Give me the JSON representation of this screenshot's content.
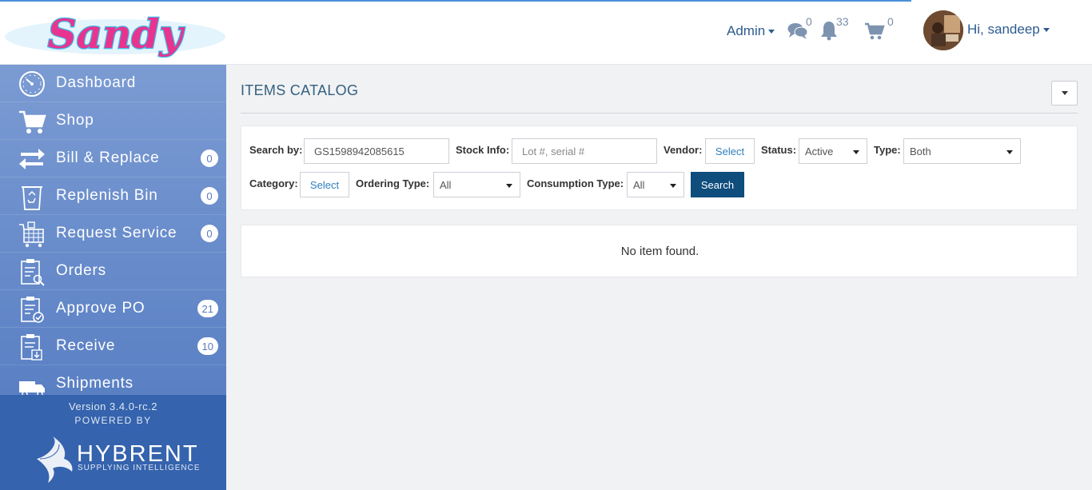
{
  "header": {
    "logo_text": "Sandy",
    "admin_label": "Admin",
    "messages_count": "0",
    "notifications_count": "33",
    "cart_count": "0",
    "greeting": "Hi, sandeep"
  },
  "sidebar": {
    "items": [
      {
        "label": "Dashboard",
        "icon": "dashboard-gauge-icon",
        "badge": ""
      },
      {
        "label": "Shop",
        "icon": "shopping-cart-icon",
        "badge": ""
      },
      {
        "label": "Bill & Replace",
        "icon": "exchange-arrows-icon",
        "badge": "0"
      },
      {
        "label": "Replenish Bin",
        "icon": "recycle-bin-icon",
        "badge": "0"
      },
      {
        "label": "Request Service",
        "icon": "service-cart-icon",
        "badge": "0"
      },
      {
        "label": "Orders",
        "icon": "clipboard-search-icon",
        "badge": ""
      },
      {
        "label": "Approve PO",
        "icon": "clipboard-check-icon",
        "badge": "21"
      },
      {
        "label": "Receive",
        "icon": "clipboard-download-icon",
        "badge": "10"
      },
      {
        "label": "Shipments",
        "icon": "truck-icon",
        "badge": ""
      }
    ],
    "version": "Version 3.4.0-rc.2",
    "powered_by": "POWERED BY",
    "brand_name": "HYBRENT",
    "brand_tagline": "SUPPLYING INTELLIGENCE"
  },
  "main": {
    "title": "ITEMS CATALOG",
    "filters": {
      "search_by_label": "Search by:",
      "search_by_value": "GS1598942085615",
      "stock_info_label": "Stock Info:",
      "stock_info_placeholder": "Lot #, serial #",
      "vendor_label": "Vendor:",
      "vendor_button": "Select",
      "status_label": "Status:",
      "status_value": "Active",
      "type_label": "Type:",
      "type_value": "Both",
      "category_label": "Category:",
      "category_button": "Select",
      "ordering_type_label": "Ordering Type:",
      "ordering_type_value": "All",
      "consumption_type_label": "Consumption Type:",
      "consumption_type_value": "All",
      "search_button": "Search"
    },
    "empty_message": "No item found."
  },
  "colors": {
    "sidebar_top": "#7b9bd3",
    "sidebar_bottom": "#5a80c4",
    "footer": "#3563ad",
    "header_link": "#2d5b8f",
    "search_button": "#0f4d7d",
    "logo_pink": "#e8348e",
    "logo_outline": "#3fb8e8"
  }
}
